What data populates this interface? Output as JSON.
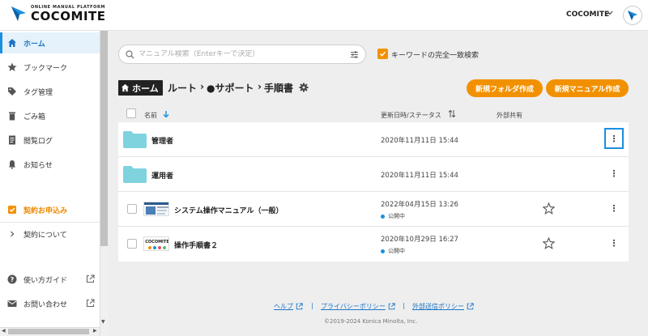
{
  "header": {
    "logo_sub": "ONLINE MANUAL PLATFORM",
    "logo_main": "COCOMITE",
    "user_name": "COCOMITE"
  },
  "sidebar": {
    "items": [
      {
        "label": "ホーム",
        "icon": "home-icon"
      },
      {
        "label": "ブックマーク",
        "icon": "star-icon"
      },
      {
        "label": "タグ管理",
        "icon": "tag-icon"
      },
      {
        "label": "ごみ箱",
        "icon": "trash-icon"
      },
      {
        "label": "閲覧ログ",
        "icon": "document-icon"
      },
      {
        "label": "お知らせ",
        "icon": "bell-icon"
      },
      {
        "label": "契約お申込み",
        "icon": "checkbox-icon"
      },
      {
        "label": "契約について",
        "icon": "chevron-right-icon"
      },
      {
        "label": "使い方ガイド",
        "icon": "help-icon"
      },
      {
        "label": "お問い合わせ",
        "icon": "mail-icon"
      }
    ]
  },
  "search": {
    "placeholder": "マニュアル検索（Enterキーで決定）",
    "exact_match_label": "キーワードの完全一致検索"
  },
  "breadcrumb": {
    "home": "ホーム",
    "root": "ルート",
    "sep": "›",
    "support": "●サポート",
    "current": "手順書"
  },
  "actions": {
    "new_folder": "新規フォルダ作成",
    "new_manual": "新規マニュアル作成"
  },
  "table": {
    "headers": {
      "name": "名前",
      "updated": "更新日時/ステータス",
      "external_share": "外部共有"
    },
    "rows": [
      {
        "type": "folder",
        "name": "管理者",
        "date": "2020年11月11日 15:44",
        "status": ""
      },
      {
        "type": "folder",
        "name": "運用者",
        "date": "2020年11月11日 15:44",
        "status": ""
      },
      {
        "type": "manual",
        "name": "システム操作マニュアル（一般）",
        "date": "2022年04月15日 13:26",
        "status": "公開中"
      },
      {
        "type": "manual",
        "name": "操作手順書２",
        "date": "2020年10月29日 16:27",
        "status": "公開中"
      }
    ]
  },
  "footer": {
    "help": "ヘルプ",
    "privacy": "プライバシーポリシー",
    "external": "外部送信ポリシー",
    "separator": "|",
    "copyright": "©2019-2024 Konica Minolta, Inc."
  },
  "colors": {
    "accent_orange": "#f29100",
    "accent_blue": "#1a8fe0",
    "folder": "#7fd3df"
  }
}
